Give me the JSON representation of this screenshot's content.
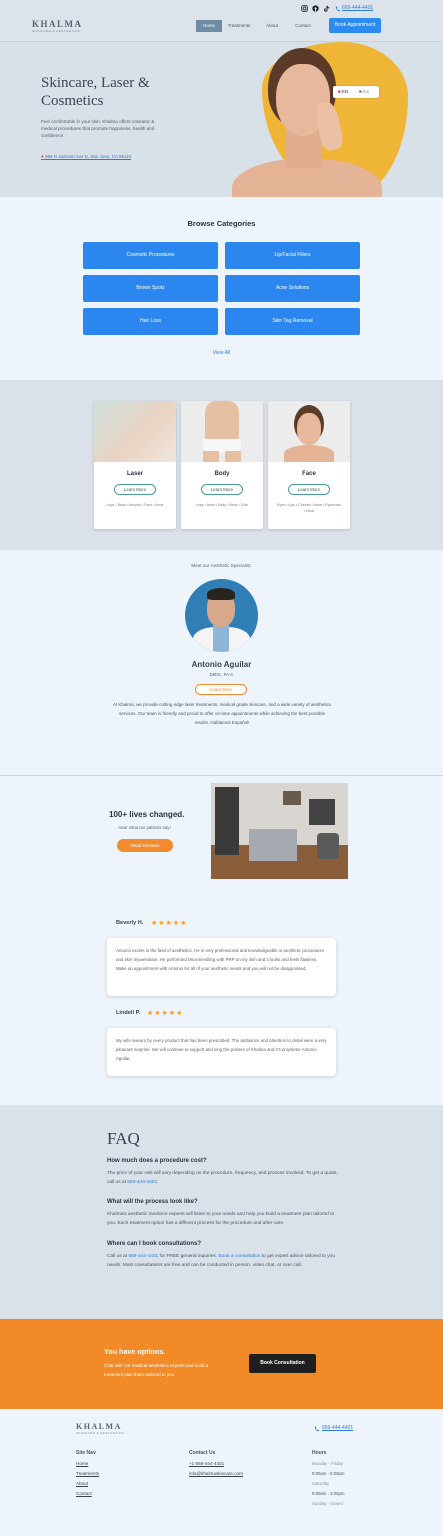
{
  "brand": {
    "name": "KHALMA",
    "tagline": "SKINCARE & AESTHETICS"
  },
  "header": {
    "phone": "669-444-4401",
    "nav": [
      "Home",
      "Treatments",
      "About",
      "Contact"
    ],
    "book_label": "Book Appointment",
    "languages": {
      "en": "EN",
      "es": "ES"
    }
  },
  "hero": {
    "title": "Skincare, Laser & Cosmetics",
    "text": "Feel comfortable in your skin. Khalma offers cosmetic & medical procedures that promote happiness, health and confidence.",
    "address": "985 N Jackson Ave D, San Jose, CA 95116"
  },
  "categories": {
    "title": "Browse Categories",
    "items": [
      "Cosmetic Procedures",
      "Lip/Facial Fillers",
      "Brown Spots",
      "Acne Solutions",
      "Hair Loss",
      "Skin Tag Removal"
    ],
    "view_all": "View All"
  },
  "services": [
    {
      "title": "Laser",
      "button": "Learn More",
      "tags": "Legs • Back • Armpits • Face • Arms"
    },
    {
      "title": "Body",
      "button": "Learn More",
      "tags": "Legs • Arms • Belly • Neck • Chin"
    },
    {
      "title": "Face",
      "button": "Learn More",
      "tags": "Eyes • Lips • Cheeks • Nose • Eyebrows • Neck"
    }
  ],
  "specialist": {
    "intro": "Meet our Aesthetic Specialist:",
    "name": "Antonio Aguilar",
    "credentials": "DMSc, PA-C",
    "button": "Learn More",
    "text": "At Khalma, we provide cutting edge laser treatments, medical grade skincare, and a wide variety of aesthetics services. Our team is friendly and proud to offer on-time appointments while achieving the best possible results. Hablamos Español!"
  },
  "reviews_banner": {
    "title": "100+ lives changed.",
    "subtitle": "Hear what our patients say!",
    "button": "Read Reviews"
  },
  "testimonials": [
    {
      "name": "Beverly H.",
      "stars": "★★★★★",
      "text": "Antonio excels in the field of aesthetics. He is very professional and knowledgeable in aesthetic procedures and skin rejuvenation. He performed Microneedling with PRP on my skin and it looks and feels flawless. Make an appointment with Antonio for all of your aesthetic needs and you will not be disappointed."
    },
    {
      "name": "Lindell P.",
      "stars": "★★★★★",
      "text": "My wife swears by every product that has been prescribed. The ambiance and attention to detail were a very pleasant surprise. We will continue to support and sing the praises of Khalma and it's proprietor Antonio Aguilar."
    }
  ],
  "faq": {
    "title": "FAQ",
    "items": [
      {
        "q": "How much does a procedure cost?",
        "a_pre": "The price of your visit will vary depending on the procedure, frequency, and process involved. To get a quote, call us at ",
        "link": "669-444-4401",
        "a_post": "."
      },
      {
        "q": "What will the process look like?",
        "a_pre": "Khalma's aesthetic medicine experts will listen to your needs and help you build a treatment plan tailored to you. Each treatment option has a different process for the procedure and after-care.",
        "link": "",
        "a_post": ""
      },
      {
        "q": "Where can I book consultations?",
        "a_pre": "Call us at ",
        "link": "669-444-4401",
        "a_mid": " for FREE general inquiries. ",
        "link2": "Book a consultation",
        "a_post": " to get expert advice tailored to you needs. Most consultations are free and can be conducted in person, video chat, or over call."
      }
    ]
  },
  "cta": {
    "title": "You have options.",
    "text": "Chat with our medical aesthetics experts and build a treatment plan that's tailored to you.",
    "button": "Book Consultation"
  },
  "footer": {
    "phone": "669-444-4401",
    "site_nav": {
      "title": "Site Nav",
      "links": [
        "Home",
        "Treatments",
        "About",
        "Contact"
      ]
    },
    "contact": {
      "title": "Contact Us",
      "phone": "+1 669-444-4401",
      "email": "info@khalmaskincare.com"
    },
    "hours": {
      "title": "Hours",
      "rows": [
        "Monday - Friday",
        "9:00am - 6:00pm",
        "Saturday",
        "9:00am - 3:00pm",
        "Sunday - closed"
      ]
    }
  },
  "colors": {
    "accent": "#2b87ef",
    "orange": "#f28a28",
    "star": "#f2a024"
  }
}
